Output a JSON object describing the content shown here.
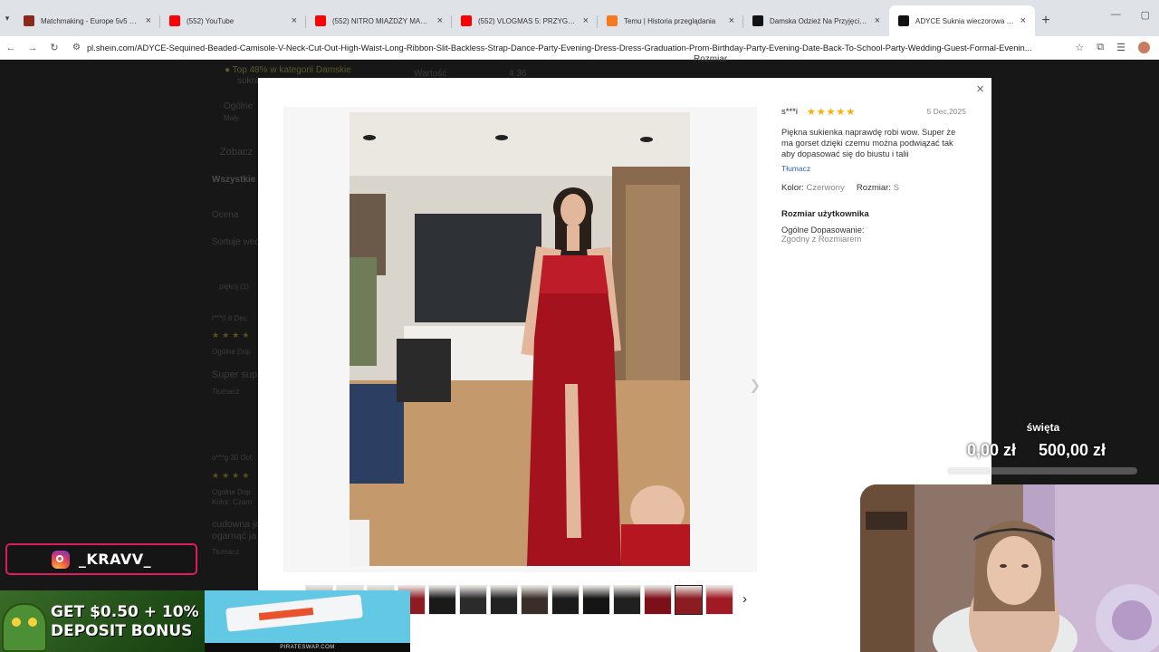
{
  "browser": {
    "tabs": [
      {
        "title": "Matchmaking - Europe 5v5 Qu...",
        "fav": "#8a2a1c"
      },
      {
        "title": "(552) YouTube",
        "fav": "#ff0000"
      },
      {
        "title": "(552) NITRO MIAŻDŻY MAMM...",
        "fav": "#ff0000"
      },
      {
        "title": "(552) VLOGMAS 5: PRZYGOTO...",
        "fav": "#ff0000"
      },
      {
        "title": "Temu | Historia przeglądania",
        "fav": "#f57a1f"
      },
      {
        "title": "Damska Odzież Na Przyjęcie | S...",
        "fav": "#111111"
      },
      {
        "title": "ADYCE Suknia wieczorowa z ce...",
        "fav": "#111111"
      }
    ],
    "url": "pl.shein.com/ADYCE-Sequined-Beaded-Camisole-V-Neck-Cut-Out-High-Waist-Long-Ribbon-Slit-Backless-Strap-Dance-Party-Evening-Dress-Dress-Graduation-Prom-Birthday-Party-Evening-Date-Back-To-School-Party-Wedding-Guest-Formal-Evenin..."
  },
  "background": {
    "category_rank_prefix": "Top 48%",
    "category_rank": "w kategorii Damskie",
    "category_rank_2": "sukni",
    "metric_value_1": "4.36",
    "metric_label": "Wartość",
    "metric_right": "Rozmiar",
    "overall_label": "Ogólne",
    "overall_sub": "Mały",
    "see_more": "Zobacz",
    "all_reviews": "Wszystkie",
    "rating_filter": "Ocena",
    "sort_label": "Sortuje wed",
    "pictures_filter": "pięknj (1)",
    "r1_user": "i***0  8 Dec",
    "r1_text": "Super sup",
    "r1_translate": "Tłumacz",
    "r1_fit": "Ogólne Dop",
    "r2_user": "o***g  30 Oct",
    "r2_fit": "Ogólne Dop",
    "r2_color": "Kolor: Czarn",
    "r2_text": "cudowna ja",
    "r2_text2": "ogarnąć ja",
    "r2_translate": "Tłumacz"
  },
  "review": {
    "user": "s***i",
    "stars": "★★★★★",
    "rating": 5,
    "date": "5 Dec,2025",
    "text": "Piękna sukienka naprawdę robi wow. Super że ma gorset dzięki czemu można podwiązać tak aby dopasować się do biustu i talii",
    "translate": "Tłumacz",
    "color_label": "Kolor:",
    "color_value": "Czerwony",
    "size_label": "Rozmiar:",
    "size_value": "S",
    "user_size_heading": "Rozmiar użytkownika",
    "fit_label": "Ogólne Dopasowanie:",
    "fit_value": "Zgodny z Rozmiarem"
  },
  "thumbnails": {
    "selected_index": 12,
    "colors": [
      "#9a8a84",
      "#b7b3ae",
      "#a19a92",
      "#8e1b22",
      "#1a1a1a",
      "#2b2b2b",
      "#222222",
      "#3a2e28",
      "#1b1b1b",
      "#151515",
      "#202020",
      "#7c1018",
      "#8a1c22",
      "#a01a25"
    ]
  },
  "stream": {
    "instagram_handle": "_KRAVV_",
    "promo_line1": "GET $0.50 + 10%",
    "promo_line2": "DEPOSIT BONUS",
    "promo_site": "PIRATESWAP.COM",
    "goal_title": "święta",
    "goal_current": "0,00 zł",
    "goal_target": "500,00 zł",
    "goal_progress": 0
  },
  "colors": {
    "star": "#f5b000",
    "link": "#2b66b8",
    "insta_border": "#e01b5c"
  },
  "icons": {
    "close": "×",
    "next": "›",
    "thumb_next": "›"
  }
}
